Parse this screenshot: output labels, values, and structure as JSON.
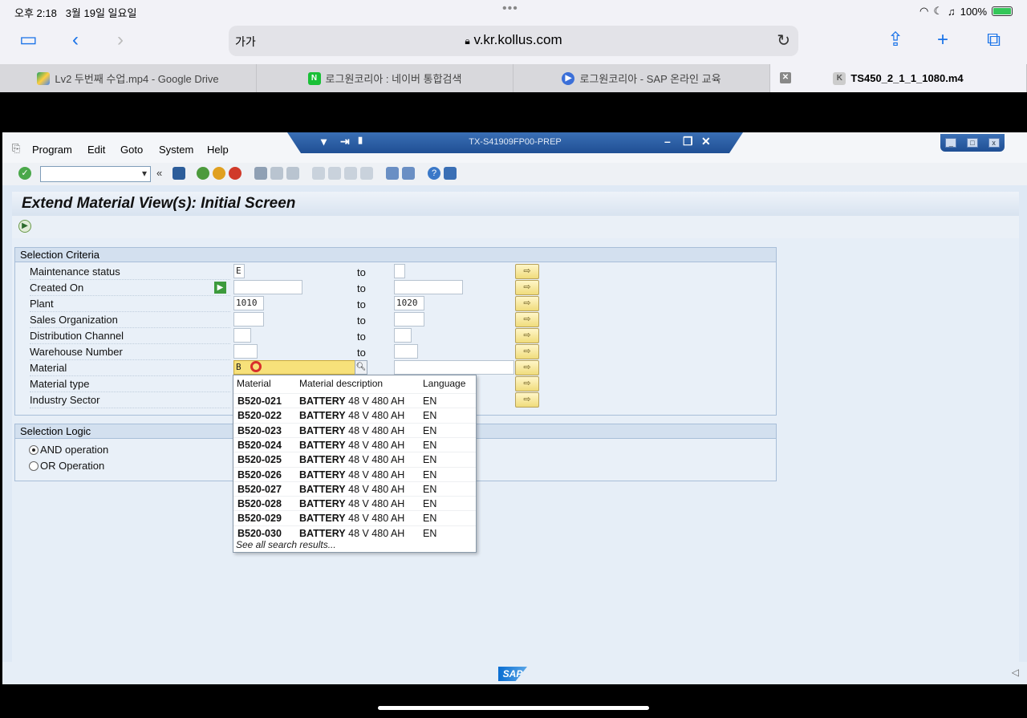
{
  "status_bar": {
    "time": "오후 2:18",
    "date": "3월 19일 일요일",
    "battery": "100%"
  },
  "safari": {
    "text_size_label": "가가",
    "url": "v.kr.kollus.com",
    "tabs": [
      {
        "label": "Lv2 두번째 수업.mp4 - Google Drive",
        "active": false
      },
      {
        "label": "로그원코리아 : 네이버 통합검색",
        "active": false
      },
      {
        "label": "로그원코리아 - SAP 온라인 교육",
        "active": false
      },
      {
        "label": "TS450_2_1_1_1080.m4",
        "active": true
      }
    ]
  },
  "sap": {
    "system_name": "TX-S41909FP00-PREP",
    "menu": [
      "Program",
      "Edit",
      "Goto",
      "System",
      "Help"
    ],
    "title": "Extend Material View(s): Initial Screen",
    "selection_criteria": {
      "heading": "Selection Criteria",
      "to_label": "to",
      "rows": [
        {
          "label": "Maintenance status",
          "from": "E",
          "to": ""
        },
        {
          "label": "Created On",
          "from": "",
          "to": ""
        },
        {
          "label": "Plant",
          "from": "1010",
          "to": "1020"
        },
        {
          "label": "Sales Organization",
          "from": "",
          "to": ""
        },
        {
          "label": "Distribution Channel",
          "from": "",
          "to": ""
        },
        {
          "label": "Warehouse Number",
          "from": "",
          "to": ""
        },
        {
          "label": "Material",
          "from": "B",
          "to": ""
        },
        {
          "label": "Material type",
          "from": "",
          "to": ""
        },
        {
          "label": "Industry Sector",
          "from": "",
          "to": ""
        }
      ]
    },
    "selection_logic": {
      "heading": "Selection Logic",
      "options": [
        {
          "label": "AND operation",
          "selected": true
        },
        {
          "label": "OR Operation",
          "selected": false
        }
      ]
    },
    "autocomplete": {
      "headers": [
        "Material",
        "Material description",
        "Language"
      ],
      "rows": [
        {
          "material": "B520-021",
          "desc_bold": "BATTERY",
          "desc_rest": "48 V 480 AH",
          "lang": "EN"
        },
        {
          "material": "B520-022",
          "desc_bold": "BATTERY",
          "desc_rest": "48 V 480 AH",
          "lang": "EN"
        },
        {
          "material": "B520-023",
          "desc_bold": "BATTERY",
          "desc_rest": "48 V 480 AH",
          "lang": "EN"
        },
        {
          "material": "B520-024",
          "desc_bold": "BATTERY",
          "desc_rest": "48 V 480 AH",
          "lang": "EN"
        },
        {
          "material": "B520-025",
          "desc_bold": "BATTERY",
          "desc_rest": "48 V 480 AH",
          "lang": "EN"
        },
        {
          "material": "B520-026",
          "desc_bold": "BATTERY",
          "desc_rest": "48 V 480 AH",
          "lang": "EN"
        },
        {
          "material": "B520-027",
          "desc_bold": "BATTERY",
          "desc_rest": "48 V 480 AH",
          "lang": "EN"
        },
        {
          "material": "B520-028",
          "desc_bold": "BATTERY",
          "desc_rest": "48 V 480 AH",
          "lang": "EN"
        },
        {
          "material": "B520-029",
          "desc_bold": "BATTERY",
          "desc_rest": "48 V 480 AH",
          "lang": "EN"
        },
        {
          "material": "B520-030",
          "desc_bold": "BATTERY",
          "desc_rest": "48 V 480 AH",
          "lang": "EN"
        }
      ],
      "see_all": "See all search results..."
    },
    "logo_text": "SAP"
  },
  "colors": {
    "sap_blue": "#1f4f94",
    "field_active": "#f7e17a",
    "group_bg": "#e9f0f8"
  }
}
